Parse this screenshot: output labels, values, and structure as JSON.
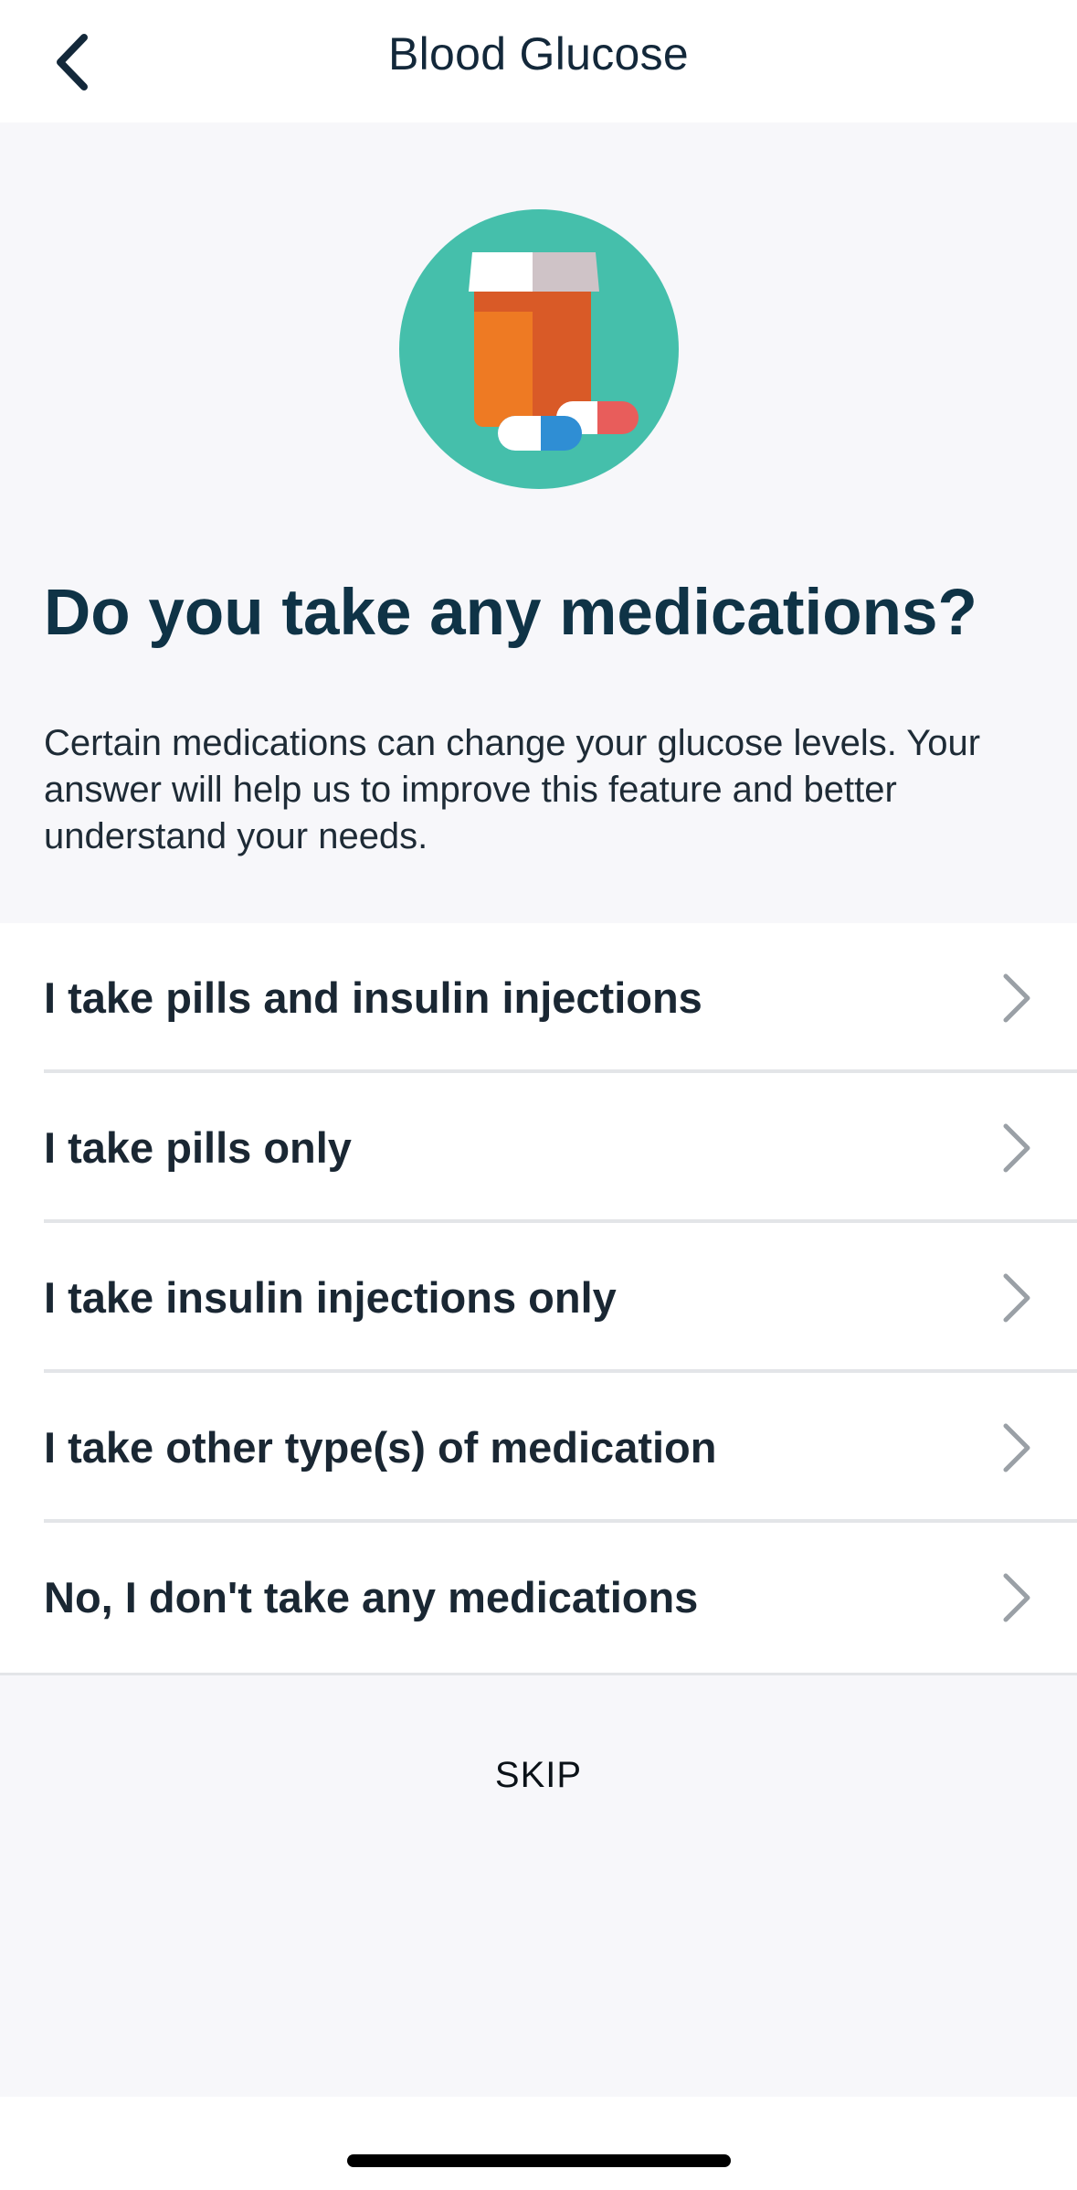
{
  "header": {
    "title": "Blood Glucose",
    "back_icon": "chevron-left-icon"
  },
  "hero": {
    "icon": "medication-bottle-icon",
    "colors": {
      "circle": "#45bfab",
      "bottle_body": "#ee7a23",
      "bottle_shade": "#d95a27",
      "cap": "#ffffff",
      "cap_shade": "#cfc3c7",
      "pill_blue": "#2f8ed4",
      "pill_red": "#e85d5b"
    }
  },
  "question": {
    "heading": "Do you take any medications?",
    "description": "Certain medications can change your glucose levels. Your answer will help us to improve this feature and better understand your needs."
  },
  "options": [
    {
      "label": "I take pills and insulin injections"
    },
    {
      "label": "I take pills only"
    },
    {
      "label": "I take insulin injections only"
    },
    {
      "label": "I take other type(s) of medication"
    },
    {
      "label": "No, I don't take any medications"
    }
  ],
  "footer": {
    "skip_label": "SKIP"
  },
  "colors": {
    "background": "#f7f7fa",
    "heading": "#0f3346",
    "chevron": "#9aa0a6",
    "divider": "#e3e5e8"
  }
}
